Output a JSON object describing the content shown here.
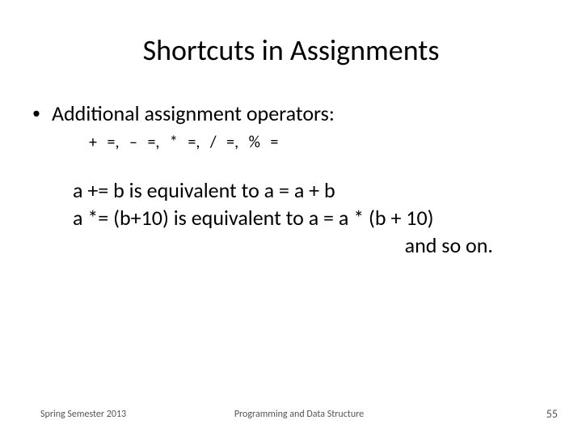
{
  "title": "Shortcuts in Assignments",
  "bullet": {
    "marker": "•",
    "text": "Additional assignment operators:"
  },
  "operators_line": "+ =,     – =,    * =,    / =,    % =",
  "body": {
    "line1": "a += b is equivalent to  a = a + b",
    "line2": "a *= (b+10) is equivalent to  a = a * (b + 10)",
    "line3": "and so on."
  },
  "footer": {
    "left": "Spring Semester 2013",
    "center": "Programming and Data Structure",
    "right": "55"
  }
}
